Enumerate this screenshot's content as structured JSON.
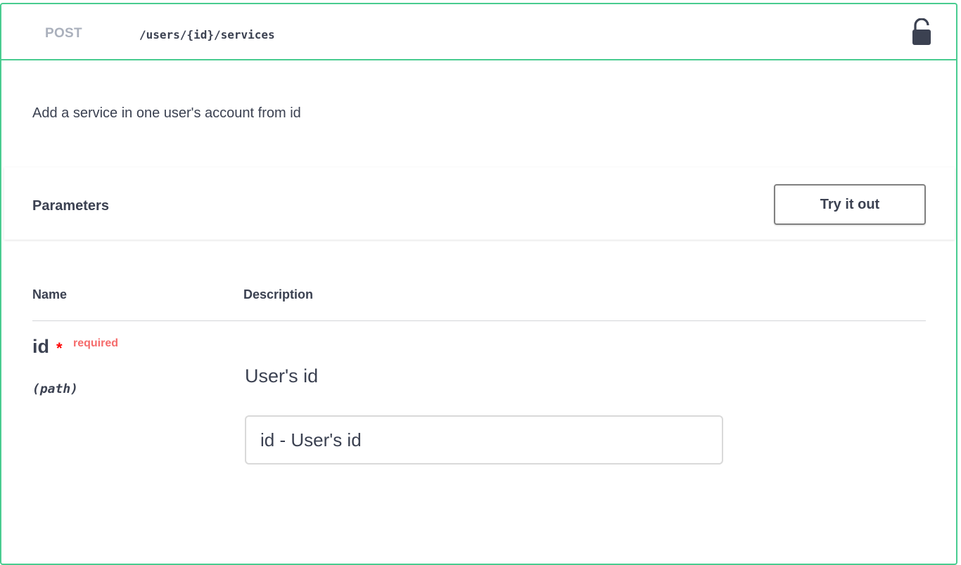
{
  "operation": {
    "method": "POST",
    "path": "/users/{id}/services",
    "description": "Add a service in one user's account from id",
    "lock_icon": "unlocked-padlock-icon"
  },
  "parameters": {
    "title": "Parameters",
    "try_it_out_label": "Try it out",
    "columns": [
      "Name",
      "Description"
    ],
    "items": [
      {
        "name": "id",
        "required_marker": "*",
        "required_label": "required",
        "location": "(path)",
        "description": "User's id",
        "input_placeholder": "id - User's id",
        "input_value": ""
      }
    ]
  },
  "colors": {
    "post_accent": "#49cc90",
    "method_text": "#aab0bc",
    "text": "#3b4151",
    "required_star": "#ff0000",
    "required_label": "#f56b6b"
  }
}
